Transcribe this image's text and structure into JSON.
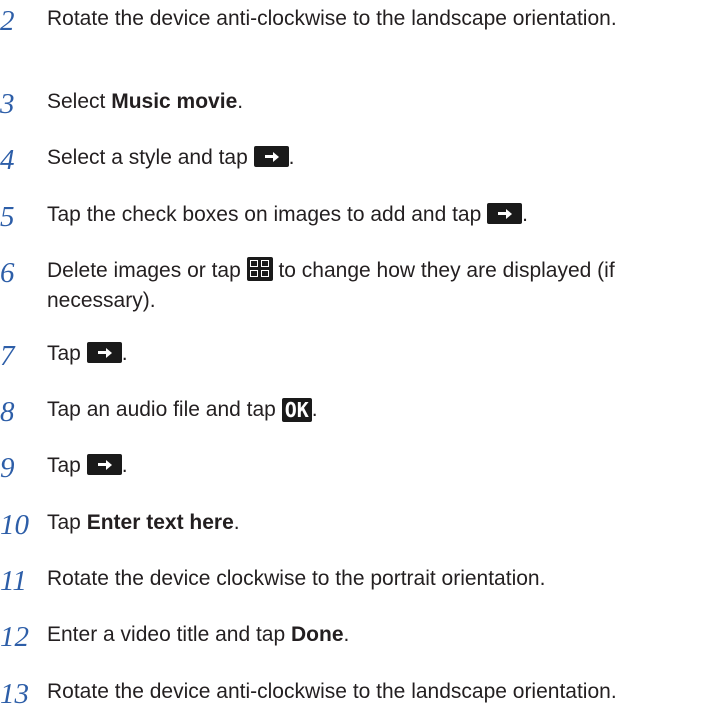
{
  "steps": [
    {
      "num": "2",
      "text": "Rotate the device anti-clockwise to the landscape orientation."
    },
    {
      "num": "3",
      "pre": "Select ",
      "bold": "Music movie",
      "post": "."
    },
    {
      "num": "4",
      "pre": "Select a style and tap ",
      "icon": "forward-arrow-icon",
      "post": "."
    },
    {
      "num": "5",
      "pre": "Tap the check boxes on images to add and tap ",
      "icon": "forward-arrow-icon",
      "post": "."
    },
    {
      "num": "6",
      "pre": "Delete images or tap ",
      "icon": "layout-grid-icon",
      "post": " to change how they are displayed (if necessary)."
    },
    {
      "num": "7",
      "pre": "Tap ",
      "icon": "forward-arrow-icon",
      "post": "."
    },
    {
      "num": "8",
      "pre": "Tap an audio file and tap ",
      "ok_label": "OK",
      "post": "."
    },
    {
      "num": "9",
      "pre": "Tap ",
      "icon": "forward-arrow-icon",
      "post": "."
    },
    {
      "num": "10",
      "pre": "Tap ",
      "bold": "Enter text here",
      "post": "."
    },
    {
      "num": "11",
      "text": "Rotate the device clockwise to the portrait orientation."
    },
    {
      "num": "12",
      "pre": "Enter a video title and tap ",
      "bold": "Done",
      "post": "."
    },
    {
      "num": "13",
      "text": "Rotate the device anti-clockwise to the landscape orientation."
    }
  ]
}
